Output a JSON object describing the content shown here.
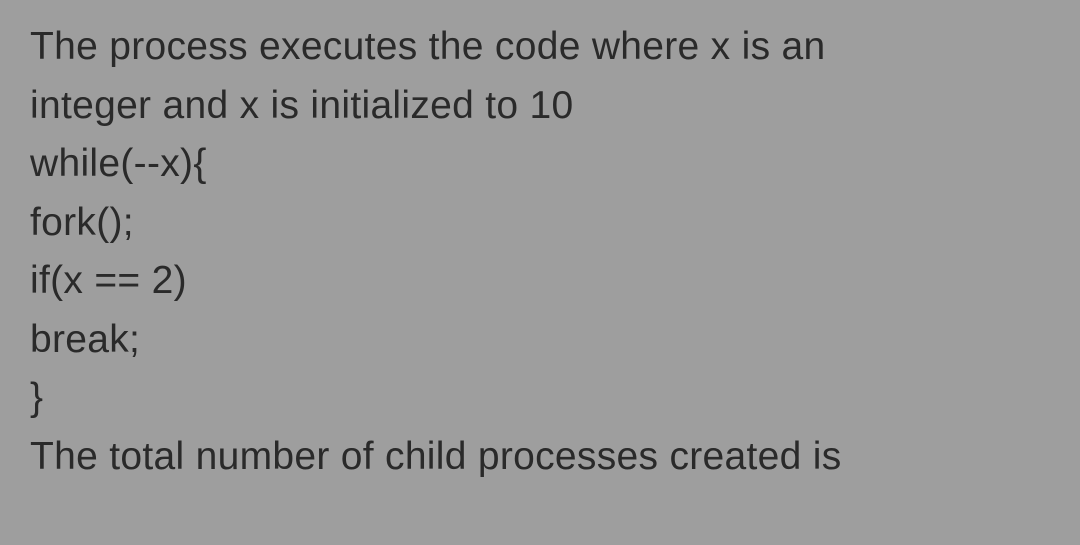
{
  "lines": {
    "l1": "The process executes the code where x is an",
    "l2": "integer and x is initialized to 10",
    "l3": "while(--x){",
    "l4": "fork();",
    "l5": "if(x == 2)",
    "l6": "break;",
    "l7": "}",
    "l8": "The total number of child processes created is"
  }
}
